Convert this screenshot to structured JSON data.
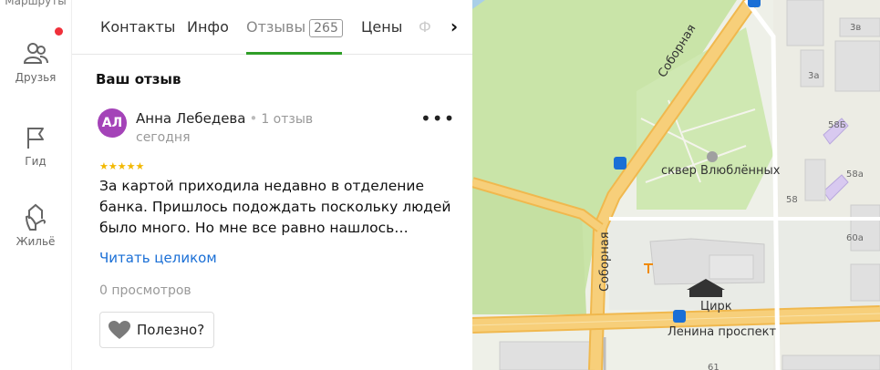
{
  "rail": {
    "top_label": "Маршруты",
    "items": [
      {
        "label": "Друзья"
      },
      {
        "label": "Гид"
      },
      {
        "label": "Жильё"
      }
    ]
  },
  "tabs": {
    "contacts": "Контакты",
    "info": "Инфо",
    "reviews": "Отзывы",
    "reviews_count": "265",
    "prices": "Цены",
    "next_partial": "Ф"
  },
  "review_section": {
    "heading": "Ваш отзыв"
  },
  "review": {
    "avatar_initials": "АЛ",
    "author": "Анна Лебедева",
    "author_reviews": "1 отзыв",
    "date": "сегодня",
    "rating": 5,
    "stars": "★★★★★",
    "text_line1": "За картой приходила недавно в отделение",
    "text_line2": "банка. Пришлось подождать поскольку людей",
    "text_line3": "было много. Но мне все равно нашлось…",
    "read_more": "Читать целиком",
    "views": "0 просмотров",
    "helpful": "Полезно?"
  },
  "map": {
    "street_sobornaya": "Соборная",
    "park": "сквер Влюблённых",
    "circus": "Цирк",
    "avenue": "Ленина проспект",
    "house_3v": "3в",
    "house_3a": "3а",
    "house_58b": "58Б",
    "house_58a": "58а",
    "house_58": "58",
    "house_60a": "60а",
    "house_61": "61",
    "colors": {
      "park": "#c9e4a8",
      "road": "#f7c86a",
      "building": "#e2e2e2"
    }
  }
}
